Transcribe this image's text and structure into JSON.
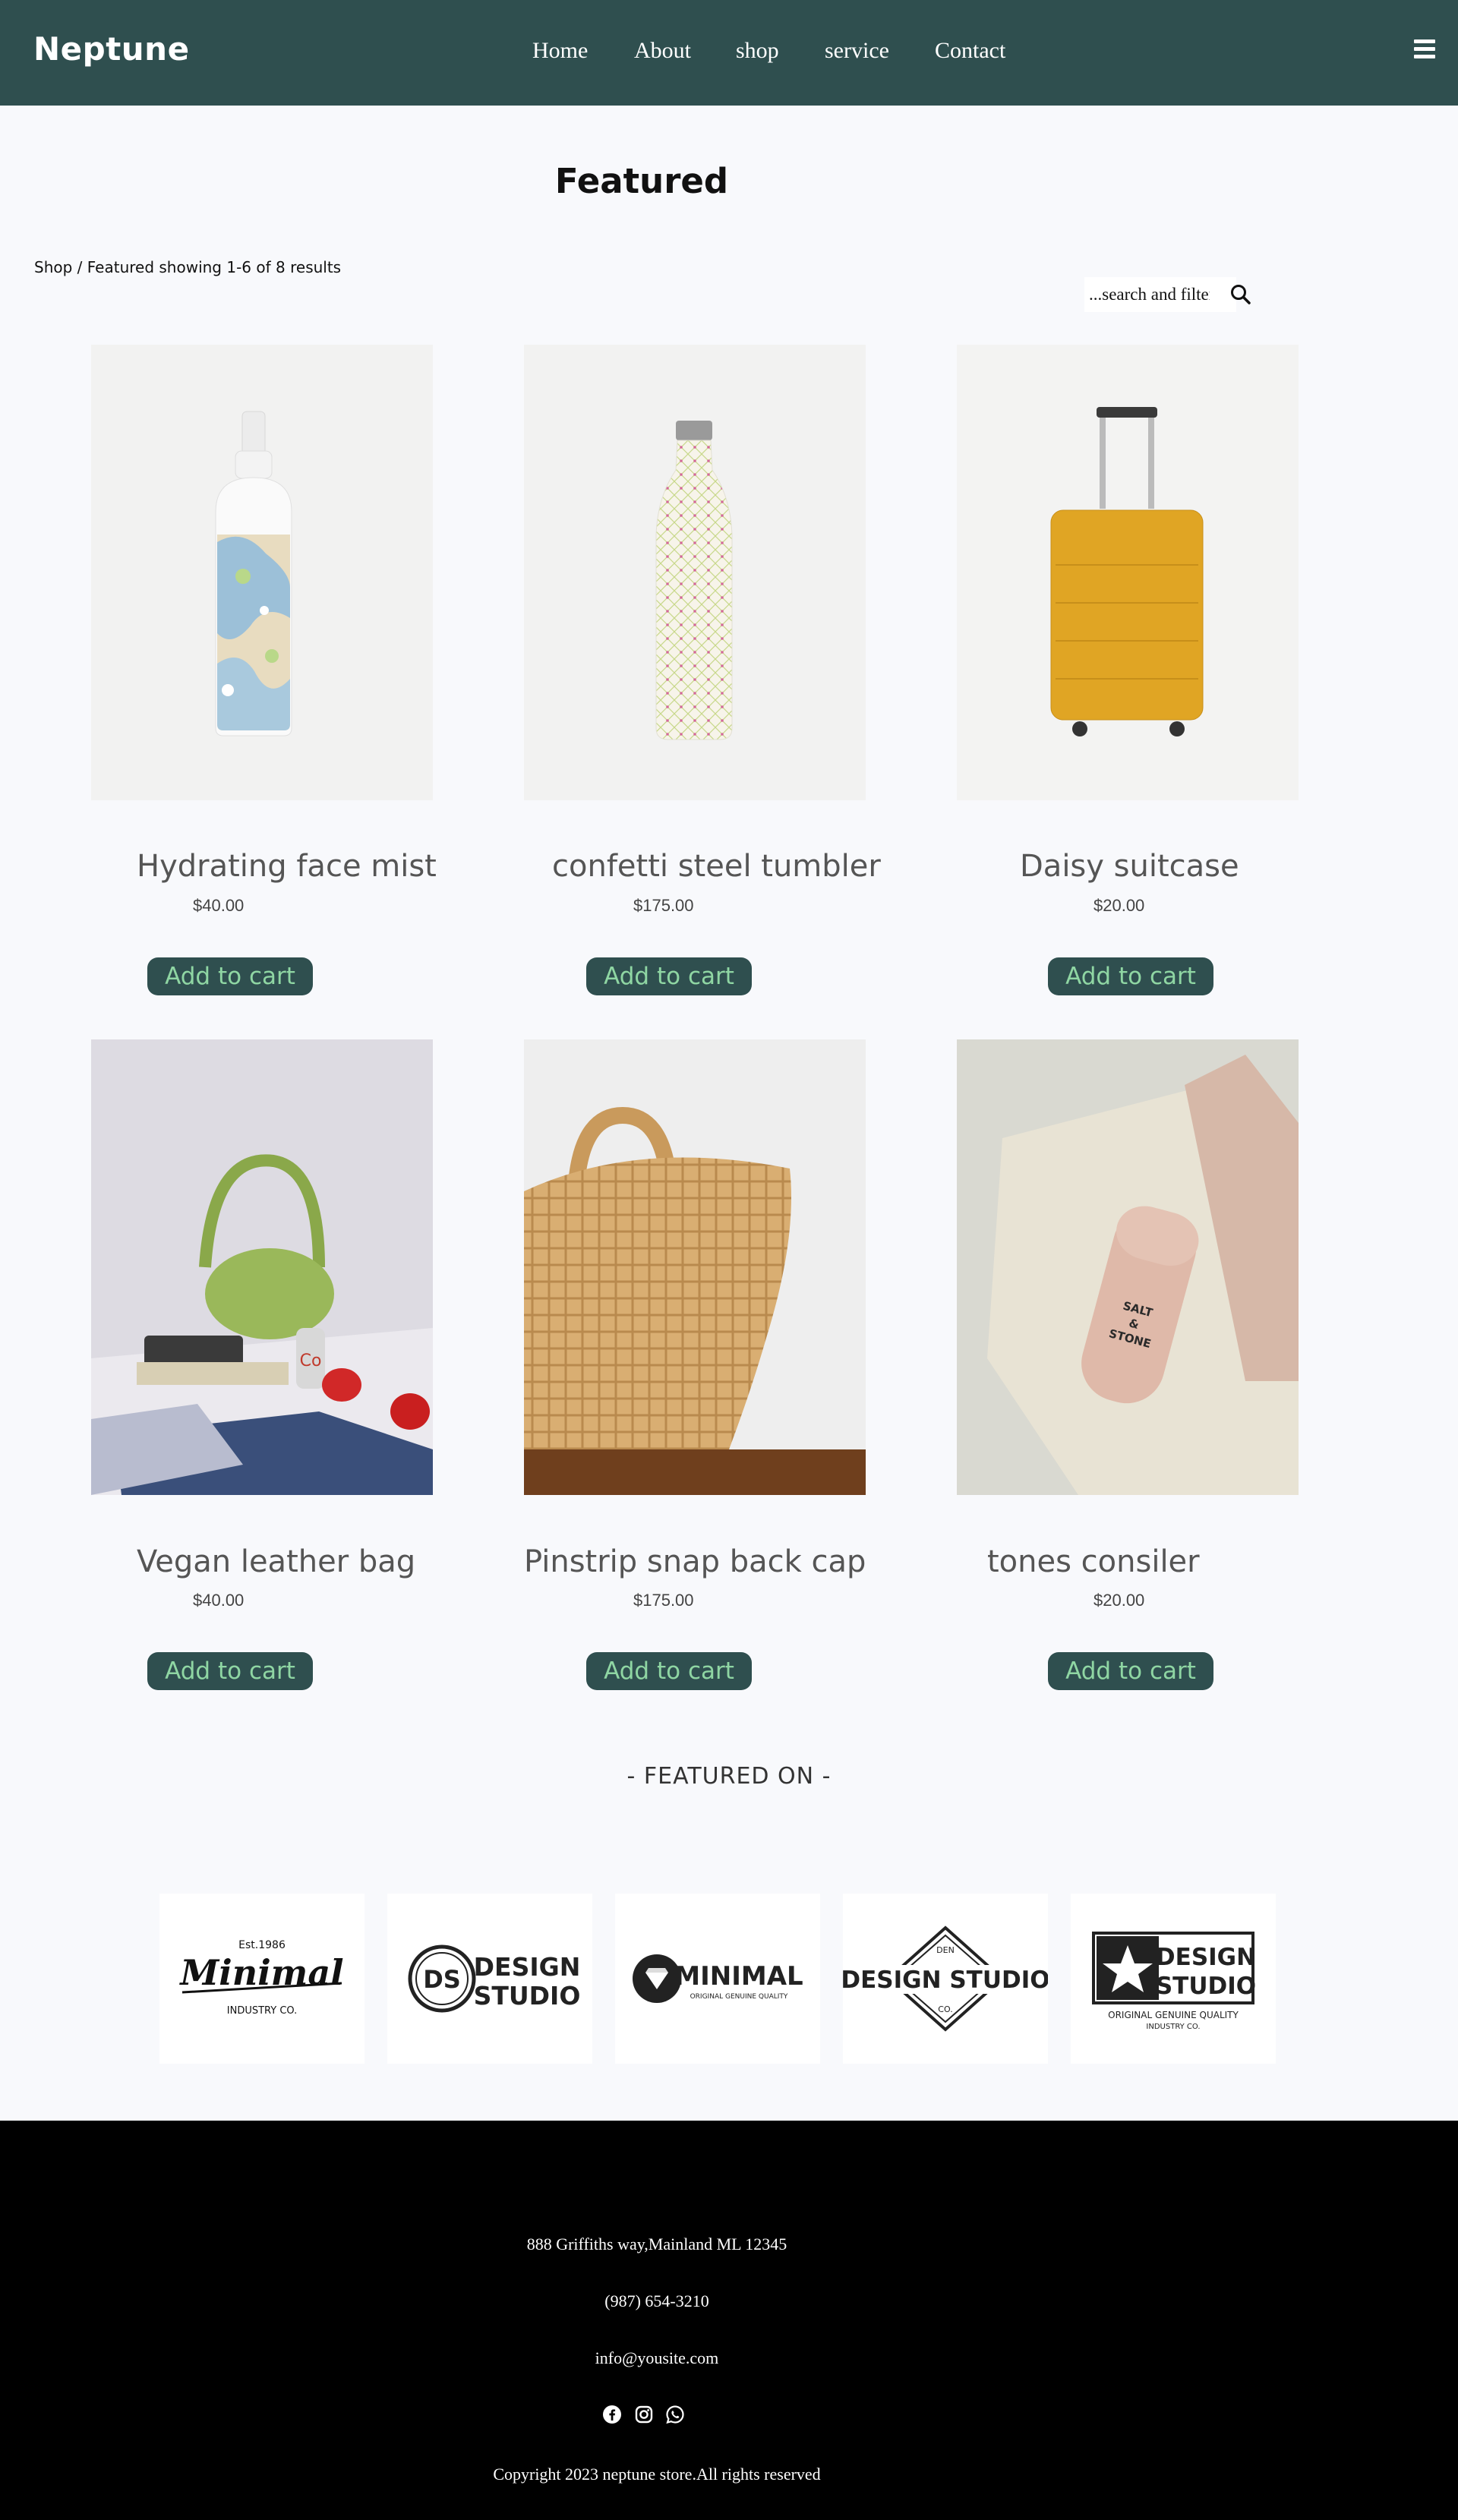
{
  "nav": {
    "brand": "Neptune",
    "links": [
      "Home",
      "About",
      "shop",
      "service",
      "Contact"
    ],
    "menu_icon": "hamburger-menu-icon"
  },
  "page": {
    "title": "Featured",
    "breadcrumb": "Shop / Featured showing 1-6 of 8 results"
  },
  "search": {
    "placeholder": "...search and filter",
    "icon": "search-icon"
  },
  "products": [
    {
      "name": "Hydrating face mist",
      "price": "$40.00",
      "button": "Add to cart"
    },
    {
      "name": "confetti steel tumbler",
      "price": "$175.00",
      "button": "Add to cart"
    },
    {
      "name": "Daisy suitcase",
      "price": "$20.00",
      "button": "Add to cart"
    },
    {
      "name": "Vegan leather bag",
      "price": "$40.00",
      "button": "Add to cart"
    },
    {
      "name": "Pinstrip snap back cap",
      "price": "$175.00",
      "button": "Add to cart"
    },
    {
      "name": "tones consiler",
      "price": "$20.00",
      "button": "Add to cart"
    }
  ],
  "featured_on": {
    "heading": "- FEATURED ON -",
    "logos": [
      {
        "name": "minimal-industry-logo",
        "lines": [
          "Est.1986",
          "Minimal",
          "INDUSTRY CO."
        ]
      },
      {
        "name": "ds-design-studio-logo",
        "lines": [
          "DS",
          "DESIGN",
          "STUDIO"
        ]
      },
      {
        "name": "minimal-diamond-logo",
        "lines": [
          "MINIMAL",
          "ORIGINAL GENUINE QUALITY"
        ]
      },
      {
        "name": "design-studio-diamond-logo",
        "lines": [
          "DEN",
          "DESIGN STUDIO",
          "CO."
        ]
      },
      {
        "name": "star-design-studio-logo",
        "lines": [
          "DESIGN",
          "STUDIO",
          "ORIGINAL GENUINE QUALITY",
          "INDUSTRY CO."
        ]
      }
    ]
  },
  "footer": {
    "address": "888 Griffiths way,Mainland ML 12345",
    "phone": "(987) 654-3210",
    "email": "info@yousite.com",
    "social_icons": [
      "facebook-icon",
      "instagram-icon",
      "whatsapp-icon"
    ],
    "copyright": "Copyright 2023 neptune store.All rights reserved"
  },
  "colors": {
    "nav_bg": "#2f4f4f",
    "button_bg": "#2f4f4f",
    "button_text": "#8fd6a3",
    "page_bg": "#f8f9fc",
    "footer_bg": "#000000"
  }
}
